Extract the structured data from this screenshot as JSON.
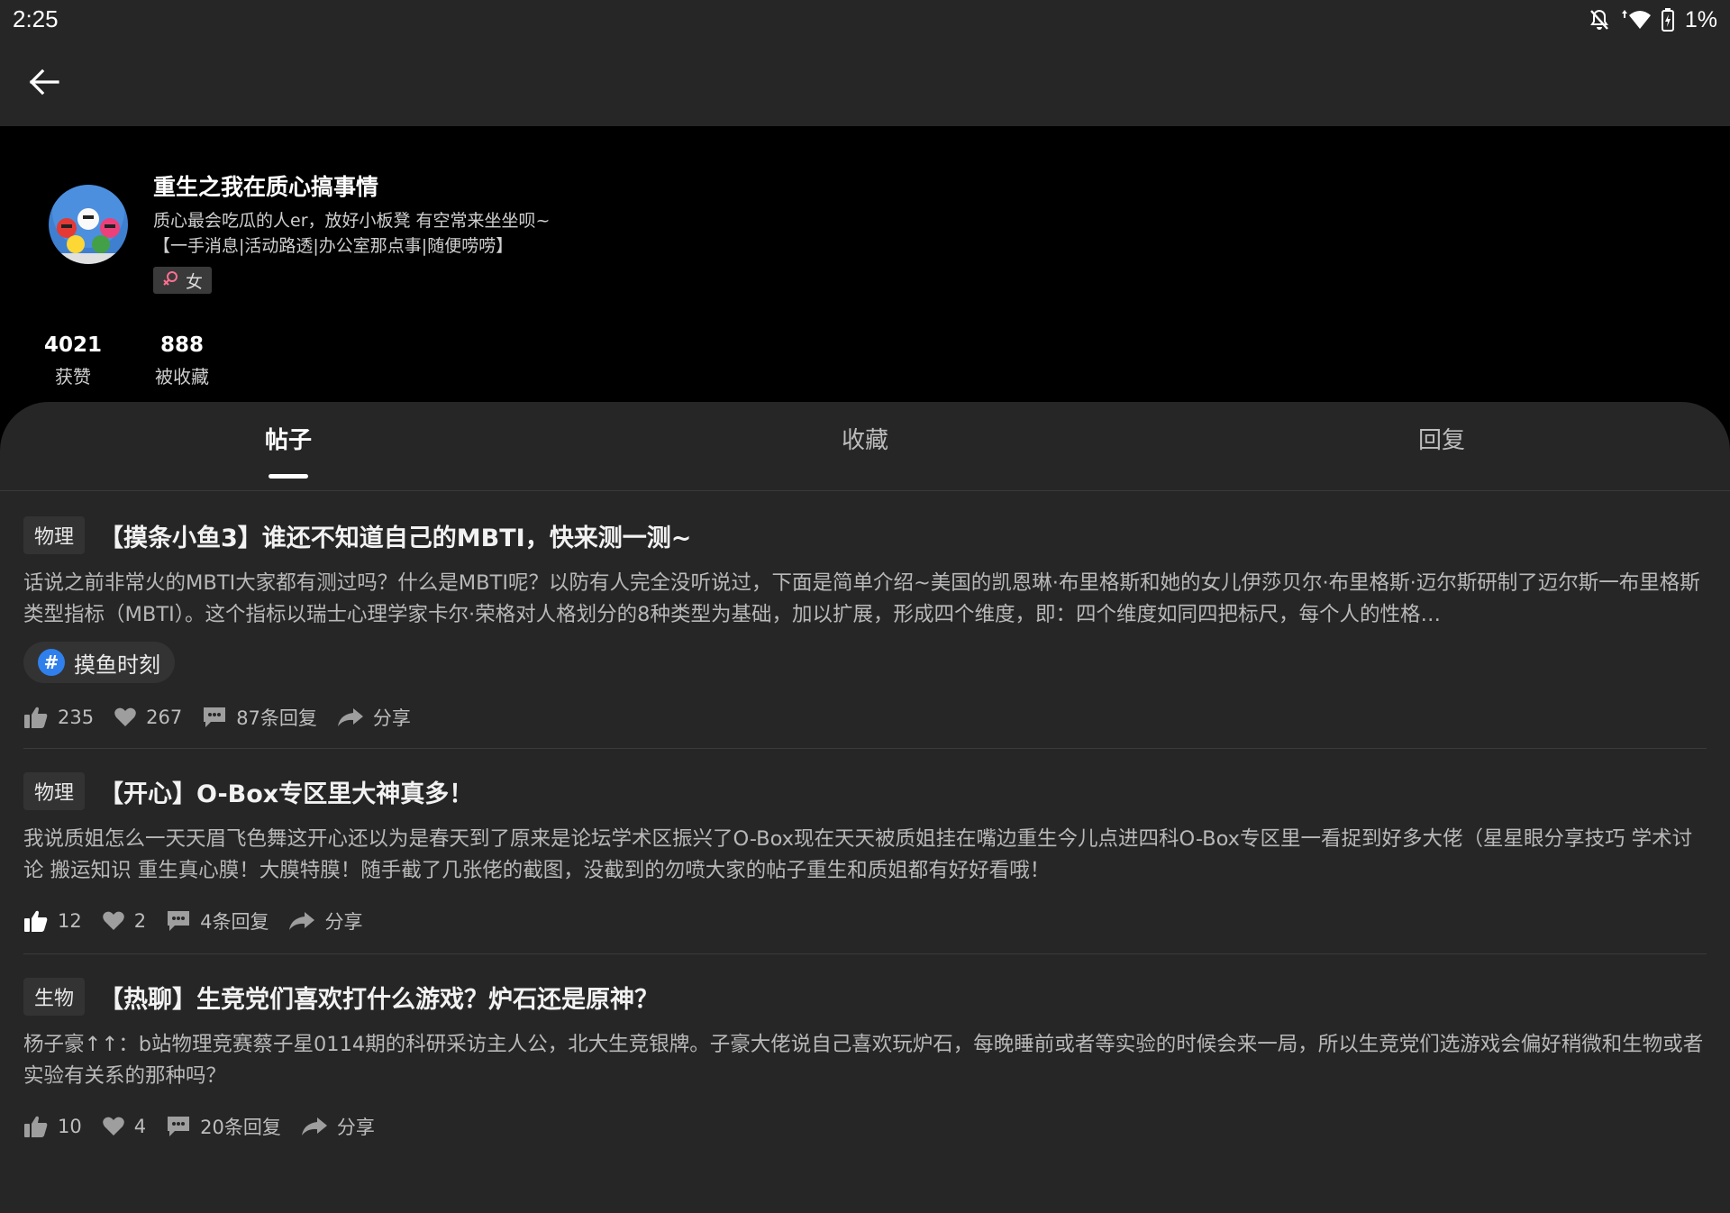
{
  "status": {
    "time": "2:25",
    "battery": "1%",
    "icons": [
      "notifications-off-icon",
      "wifi-icon",
      "battery-charging-icon"
    ]
  },
  "header": {
    "back_icon": "arrow-left-icon"
  },
  "profile": {
    "name": "重生之我在质心搞事情",
    "bio_line1": "质心最会吃瓜的人er，放好小板凳 有空常来坐坐呗~",
    "bio_line2": "【一手消息|活动路透|办公室那点事|随便唠唠】",
    "gender": "女",
    "gender_icon": "female-icon",
    "stats": [
      {
        "value": "4021",
        "label": "获赞"
      },
      {
        "value": "888",
        "label": "被收藏"
      }
    ]
  },
  "tabs": [
    {
      "label": "帖子",
      "active": true
    },
    {
      "label": "收藏",
      "active": false
    },
    {
      "label": "回复",
      "active": false
    }
  ],
  "posts": [
    {
      "category": "物理",
      "title": "【摸条小鱼3】谁还不知道自己的MBTI，快来测一测~",
      "excerpt": "话说之前非常火的MBTI大家都有测过吗？什么是MBTI呢？以防有人完全没听说过，下面是简单介绍~美国的凯恩琳·布里格斯和她的女儿伊莎贝尔·布里格斯·迈尔斯研制了迈尔斯一布里格斯类型指标（MBTI）。这个指标以瑞士心理学家卡尔·荣格对人格划分的8种类型为基础，加以扩展，形成四个维度，即：四个维度如同四把标尺，每个人的性格…",
      "topic": "摸鱼时刻",
      "likes": "235",
      "favorites": "267",
      "replies": "87条回复",
      "share": "分享",
      "liked": false
    },
    {
      "category": "物理",
      "title": "【开心】O-Box专区里大神真多！",
      "excerpt": "我说质姐怎么一天天眉飞色舞这开心还以为是春天到了原来是论坛学术区振兴了O-Box现在天天被质姐挂在嘴边重生今儿点进四科O-Box专区里一看捉到好多大佬（星星眼分享技巧 学术讨论  搬运知识 重生真心膜！大膜特膜！随手截了几张佬的截图，没截到的勿喷大家的帖子重生和质姐都有好好看哦！",
      "topic": "",
      "likes": "12",
      "favorites": "2",
      "replies": "4条回复",
      "share": "分享",
      "liked": true
    },
    {
      "category": "生物",
      "title": "【热聊】生竞党们喜欢打什么游戏？炉石还是原神？",
      "excerpt": "杨子豪↑↑：b站物理竞赛蔡子星0114期的科研采访主人公，北大生竞银牌。子豪大佬说自己喜欢玩炉石，每晚睡前或者等实验的时候会来一局，所以生竞党们选游戏会偏好稍微和生物或者实验有关系的那种吗？",
      "topic": "",
      "likes": "10",
      "favorites": "4",
      "replies": "20条回复",
      "share": "分享",
      "liked": false
    }
  ]
}
